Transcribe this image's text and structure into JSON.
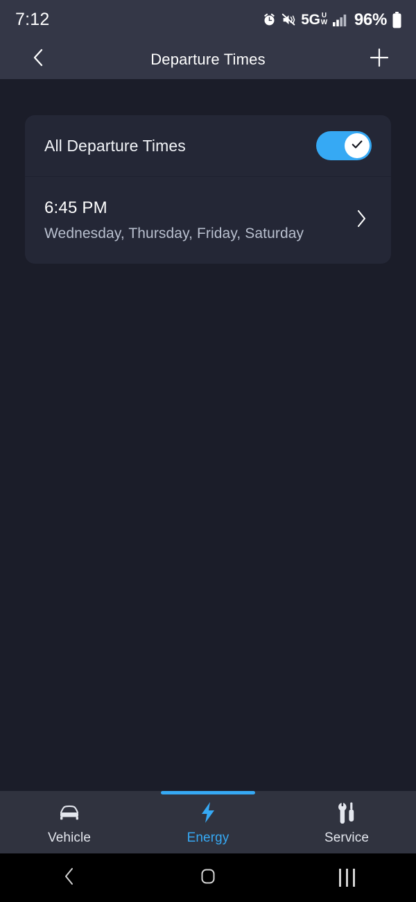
{
  "status_bar": {
    "time": "7:12",
    "battery_percent": "96%",
    "network": "5G",
    "network_sub_top": "U",
    "network_sub_bottom": "W",
    "icons": [
      "alarm-icon",
      "mute-vibrate-icon",
      "network-5g-uw-icon",
      "signal-bars-icon",
      "battery-icon"
    ]
  },
  "header": {
    "title": "Departure Times",
    "back_icon": "chevron-left-icon",
    "add_icon": "plus-icon"
  },
  "card": {
    "toggle_row": {
      "label": "All Departure Times",
      "toggle_state": "on",
      "toggle_check_icon": "check-icon"
    },
    "time_row": {
      "time": "6:45 PM",
      "days": "Wednesday, Thursday, Friday, Saturday",
      "chevron_icon": "chevron-right-icon"
    }
  },
  "tabs": [
    {
      "label": "Vehicle",
      "icon": "car-icon",
      "active": false
    },
    {
      "label": "Energy",
      "icon": "lightning-bolt-icon",
      "active": true
    },
    {
      "label": "Service",
      "icon": "wrench-screwdriver-icon",
      "active": false
    }
  ],
  "android_nav": {
    "back_icon": "nav-back-icon",
    "home_icon": "nav-home-icon",
    "recents_icon": "nav-recents-icon"
  },
  "colors": {
    "page_background": "#1b1d29",
    "bar_background": "#343747",
    "card_background": "#242736",
    "tabbar_background": "#30333f",
    "accent": "#36a9f4",
    "primary_text": "#ffffff",
    "secondary_text": "#b9c0cf"
  }
}
